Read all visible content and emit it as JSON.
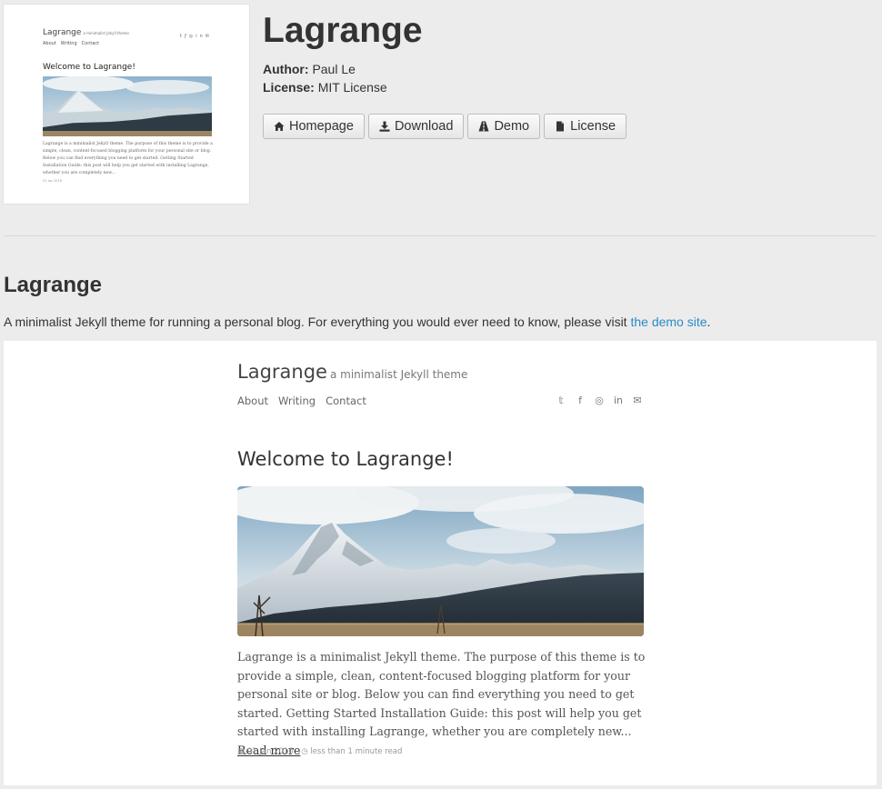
{
  "theme": {
    "title": "Lagrange",
    "author_label": "Author:",
    "author": "Paul Le",
    "license_label": "License:",
    "license": "MIT License"
  },
  "buttons": [
    {
      "label": "Homepage",
      "icon": "home-icon"
    },
    {
      "label": "Download",
      "icon": "download-icon"
    },
    {
      "label": "Demo",
      "icon": "road-icon"
    },
    {
      "label": "License",
      "icon": "file-icon"
    }
  ],
  "section": {
    "title": "Lagrange",
    "description": "A minimalist Jekyll theme for running a personal blog. For everything you would ever need to know, please visit ",
    "link_text": "the demo site",
    "period": "."
  },
  "preview": {
    "site_title": "Lagrange",
    "site_tagline": "a minimalist Jekyll theme",
    "nav": [
      "About",
      "Writing",
      "Contact"
    ],
    "social_icons": [
      "twitter-icon",
      "facebook-icon",
      "instagram-icon",
      "linkedin-icon",
      "envelope-icon"
    ],
    "post_title": "Welcome to Lagrange!",
    "excerpt": "Lagrange is a minimalist Jekyll theme. The purpose of this theme is to provide a simple, clean, content-focused blogging platform for your personal site or blog. Below you can find everything you need to get started. Getting Started Installation Guide: this post will help you get started with installing Lagrange, whether you are completely new... ",
    "read_more": "Read more",
    "date": "01 Jan 2016",
    "separator": "-",
    "read_time": "less than 1 minute read"
  },
  "colors": {
    "page_bg": "#ececec",
    "link": "#2a8bc7",
    "heading": "#333333"
  }
}
